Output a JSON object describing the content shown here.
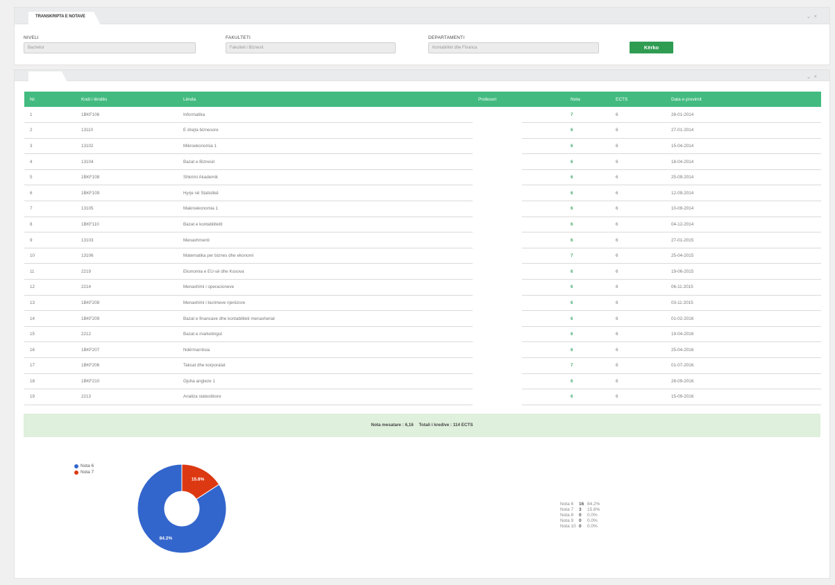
{
  "search_panel": {
    "tab_title": "TRANSKRIPTA E NOTAVE",
    "fields": [
      {
        "label": "NIVELI",
        "value": "Bachelor"
      },
      {
        "label": "FAKULTETI",
        "value": "Fakulteti i Biznesit"
      },
      {
        "label": "DEPARTAMENTI",
        "value": "Kontabilitet dhe Financa"
      }
    ],
    "search_button": "Kërko"
  },
  "window_controls": {
    "collapse": "⌄",
    "close": "×"
  },
  "table": {
    "headers": [
      "Nr.",
      "Kodi i lëndës",
      "Lënda",
      "Profesori",
      "Nota",
      "ECTS",
      "Data e provimit"
    ],
    "rows": [
      {
        "nr": "1",
        "kodi": "1BKF106",
        "lenda": "Informatika",
        "profesori": "",
        "nota": "7",
        "ects": "6",
        "data": "28-01-2014"
      },
      {
        "nr": "2",
        "kodi": "13110",
        "lenda": "E drejta biznesore",
        "profesori": "",
        "nota": "6",
        "ects": "6",
        "data": "27-01-2014"
      },
      {
        "nr": "3",
        "kodi": "13102",
        "lenda": "Mikroekonomia 1",
        "profesori": "",
        "nota": "6",
        "ects": "6",
        "data": "15-04-2014"
      },
      {
        "nr": "4",
        "kodi": "13104",
        "lenda": "Bazat e Biznesit",
        "profesori": "",
        "nota": "6",
        "ects": "6",
        "data": "18-04-2014"
      },
      {
        "nr": "5",
        "kodi": "1BKF108",
        "lenda": "Shkrimi Akademik",
        "profesori": "",
        "nota": "6",
        "ects": "6",
        "data": "25-09-2014"
      },
      {
        "nr": "6",
        "kodi": "1BKF109",
        "lenda": "Hyrje në Statistikë",
        "profesori": "",
        "nota": "6",
        "ects": "6",
        "data": "12-09-2014"
      },
      {
        "nr": "7",
        "kodi": "13105",
        "lenda": "Makroekonomia 1",
        "profesori": "",
        "nota": "6",
        "ects": "6",
        "data": "10-09-2014"
      },
      {
        "nr": "8",
        "kodi": "1BKF110",
        "lenda": "Bazat e kontabilitetit",
        "profesori": "",
        "nota": "6",
        "ects": "6",
        "data": "04-12-2014"
      },
      {
        "nr": "9",
        "kodi": "13103",
        "lenda": "Menaxhmenti",
        "profesori": "",
        "nota": "6",
        "ects": "6",
        "data": "27-01-2015"
      },
      {
        "nr": "10",
        "kodi": "13106",
        "lenda": "Matematika per biznes dhe ekonomi",
        "profesori": "",
        "nota": "7",
        "ects": "6",
        "data": "25-04-2015"
      },
      {
        "nr": "11",
        "kodi": "2219",
        "lenda": "Ekonomia e EU-së dhe Kosova",
        "profesori": "",
        "nota": "6",
        "ects": "6",
        "data": "19-06-2015"
      },
      {
        "nr": "12",
        "kodi": "2214",
        "lenda": "Menaxhimi i operacioneve",
        "profesori": "",
        "nota": "6",
        "ects": "6",
        "data": "06-11-2015"
      },
      {
        "nr": "13",
        "kodi": "1BKF208",
        "lenda": "Menaxhimi i burimeve njerëzore",
        "profesori": "",
        "nota": "6",
        "ects": "6",
        "data": "03-11-2015"
      },
      {
        "nr": "14",
        "kodi": "1BKF209",
        "lenda": "Bazat e financave dhe kontabiliteti menaxherial",
        "profesori": "",
        "nota": "6",
        "ects": "6",
        "data": "01-02-2016"
      },
      {
        "nr": "15",
        "kodi": "2212",
        "lenda": "Bazat e marketingut",
        "profesori": "",
        "nota": "6",
        "ects": "6",
        "data": "19-04-2016"
      },
      {
        "nr": "16",
        "kodi": "1BKF207",
        "lenda": "Ndërmarrësia",
        "profesori": "",
        "nota": "6",
        "ects": "6",
        "data": "25-04-2016"
      },
      {
        "nr": "17",
        "kodi": "1BKF206",
        "lenda": "Taksat dhe korporatat",
        "profesori": "",
        "nota": "7",
        "ects": "6",
        "data": "01-07-2016"
      },
      {
        "nr": "18",
        "kodi": "1BKF210",
        "lenda": "Gjuha angleze 1",
        "profesori": "",
        "nota": "6",
        "ects": "6",
        "data": "28-09-2016"
      },
      {
        "nr": "19",
        "kodi": "2213",
        "lenda": "Analiza statestikore",
        "profesori": "",
        "nota": "6",
        "ects": "6",
        "data": "15-09-2016"
      }
    ]
  },
  "summary": {
    "average": "Nota mesatare : 6,16",
    "credits": "Totali i kredive : 114 ECTS"
  },
  "chart_data": {
    "type": "pie",
    "donut": true,
    "categories": [
      "Nota 6",
      "Nota 7"
    ],
    "values": [
      84.2,
      15.8
    ],
    "labels": [
      "84.2%",
      "15.8%"
    ],
    "colors": [
      "#3366cc",
      "#dc3912"
    ],
    "legend_position": "top-left"
  },
  "grade_stats": [
    {
      "name": "Nota 6",
      "count": "16",
      "pct": "84.2%"
    },
    {
      "name": "Nota 7",
      "count": "3",
      "pct": "15.8%"
    },
    {
      "name": "Nota 8",
      "count": "0",
      "pct": "0.0%"
    },
    {
      "name": "Nota 9",
      "count": "0",
      "pct": "0.0%"
    },
    {
      "name": "Nota 10",
      "count": "0",
      "pct": "0.0%"
    }
  ]
}
